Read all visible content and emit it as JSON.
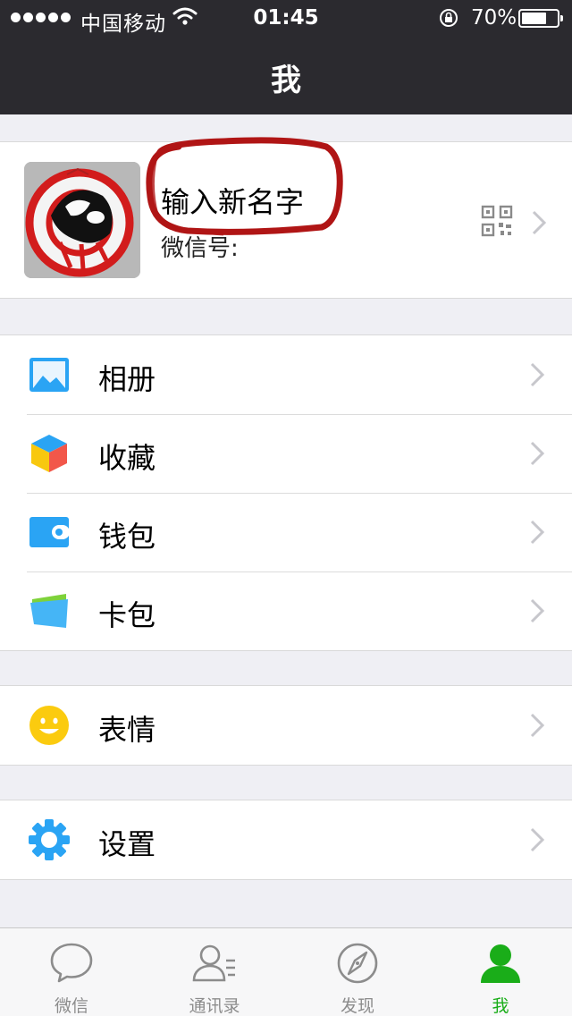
{
  "status_bar": {
    "carrier": "中国移动",
    "time": "01:45",
    "battery": "70%",
    "battery_level": 0.7
  },
  "nav": {
    "title": "我"
  },
  "profile": {
    "name": "输入新名字",
    "wechat_id_label": "微信号:"
  },
  "menu_groups": [
    {
      "items": [
        {
          "label": "相册",
          "icon": "album-icon"
        },
        {
          "label": "收藏",
          "icon": "favorites-icon"
        },
        {
          "label": "钱包",
          "icon": "wallet-icon"
        },
        {
          "label": "卡包",
          "icon": "card-package-icon"
        }
      ]
    },
    {
      "items": [
        {
          "label": "表情",
          "icon": "sticker-icon"
        }
      ]
    },
    {
      "items": [
        {
          "label": "设置",
          "icon": "settings-gear-icon"
        }
      ]
    }
  ],
  "tabs": [
    {
      "label": "微信",
      "icon": "chat-bubble-icon",
      "active": false
    },
    {
      "label": "通讯录",
      "icon": "contacts-icon",
      "active": false
    },
    {
      "label": "发现",
      "icon": "compass-icon",
      "active": false
    },
    {
      "label": "我",
      "icon": "person-icon",
      "active": true
    }
  ],
  "colors": {
    "nav_bg": "#2b2a2f",
    "page_bg": "#efeff4",
    "active_tab": "#1aad19",
    "annotation_red": "#b01515"
  }
}
